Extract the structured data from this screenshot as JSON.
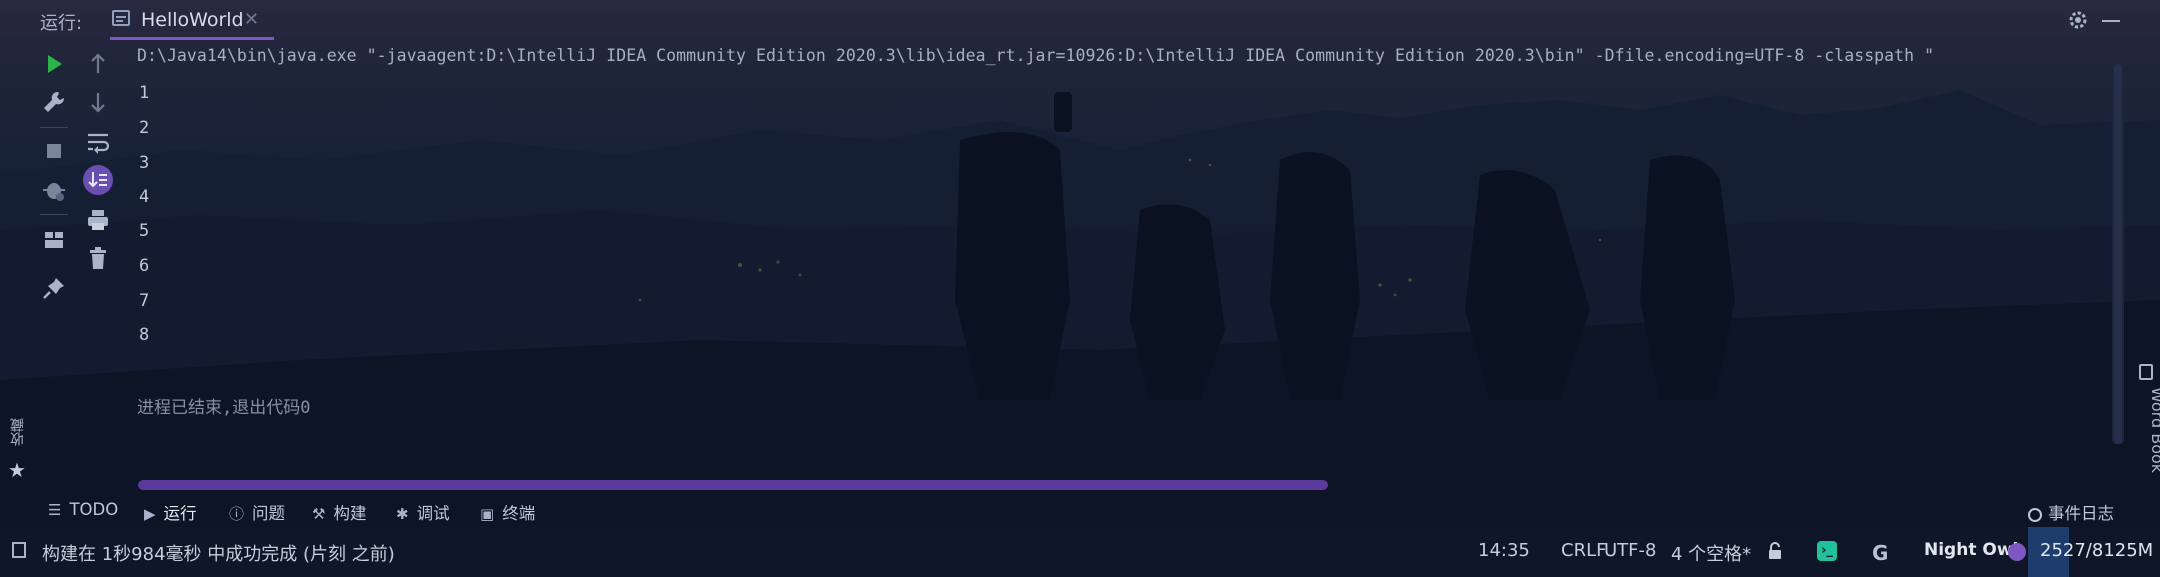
{
  "colors": {
    "accent": "#7e57c2",
    "background": "#0f1a2e",
    "run_icon": "#2bb34a",
    "terminal_badge": "#21c29a",
    "memory_fill": "#1f3d6c"
  },
  "tabbar": {
    "run_label": "运行:",
    "tab_title": "HelloWorld",
    "tab_close": "✕",
    "settings_icon": "gear-icon",
    "minimize_icon": "minimize-icon"
  },
  "left_toolbar": {
    "icons": [
      "run-icon",
      "wrench-icon",
      "stop-icon",
      "debug-bug-icon",
      "layout-icon",
      "pin-icon"
    ]
  },
  "second_toolbar": {
    "icons": [
      "arrow-up-icon",
      "arrow-down-icon",
      "soft-wrap-icon",
      "scroll-to-end-icon",
      "print-icon",
      "trash-icon"
    ]
  },
  "console": {
    "command": "D:\\Java14\\bin\\java.exe \"-javaagent:D:\\IntelliJ IDEA Community Edition 2020.3\\lib\\idea_rt.jar=10926:D:\\IntelliJ IDEA Community Edition 2020.3\\bin\" -Dfile.encoding=UTF-8 -classpath \"",
    "output_lines": [
      "1",
      "2",
      "3",
      "4",
      "5",
      "6",
      "7",
      "8"
    ],
    "exit_message": "进程已结束,退出代码0"
  },
  "sidebars": {
    "word_book": "Word Book",
    "favorites": "收藏"
  },
  "bottom_tools": {
    "todo": "TODO",
    "run": "运行",
    "problems": "问题",
    "build": "构建",
    "debug": "调试",
    "terminal": "终端",
    "event_log": "事件日志"
  },
  "status_bar": {
    "message": "构建在 1秒984毫秒 中成功完成 (片刻 之前)",
    "position": "14:35",
    "line_sep": "CRLF",
    "encoding": "UTF-8",
    "indent": "4 个空格*",
    "google_badge": "G",
    "theme": "Night Owl",
    "memory": "2527/8125M",
    "memory_used_fraction": 0.31
  }
}
